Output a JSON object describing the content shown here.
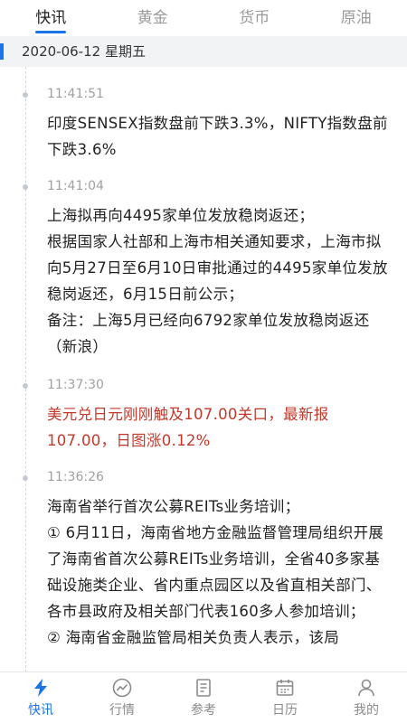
{
  "tabs": [
    {
      "label": "快讯",
      "active": true
    },
    {
      "label": "黄金",
      "active": false
    },
    {
      "label": "货币",
      "active": false
    },
    {
      "label": "原油",
      "active": false
    }
  ],
  "date_header": "2020-06-12 星期五",
  "news": [
    {
      "time": "11:41:51",
      "lines": [
        "印度SENSEX指数盘前下跌3.3%，NIFTY指数盘前下跌3.6%"
      ],
      "highlight": false
    },
    {
      "time": "11:41:04",
      "lines": [
        "上海拟再向4495家单位发放稳岗返还；",
        "根据国家人社部和上海市相关通知要求，上海市拟向5月27日至6月10日审批通过的4495家单位发放稳岗返还，6月15日前公示；",
        "备注：上海5月已经向6792家单位发放稳岗返还　（新浪）"
      ],
      "highlight": false
    },
    {
      "time": "11:37:30",
      "lines": [
        "美元兑日元刚刚触及107.00关口，最新报107.00，日图涨0.12%"
      ],
      "highlight": true,
      "highlight_color": "#c0392b"
    },
    {
      "time": "11:36:26",
      "lines": [
        "海南省举行首次公募REITs业务培训；",
        "① 6月11日，海南省地方金融监督管理局组织开展了海南省首次公募REITs业务培训，全省40多家基础设施类企业、省内重点园区以及省直相关部门、各市县政府及相关部门代表160多人参加培训；",
        "② 海南省金融监管局相关负责人表示，该局"
      ],
      "highlight": false
    }
  ],
  "bottom_nav": [
    {
      "label": "快讯",
      "icon": "lightning-icon",
      "active": true
    },
    {
      "label": "行情",
      "icon": "market-chart-icon",
      "active": false
    },
    {
      "label": "参考",
      "icon": "document-icon",
      "active": false
    },
    {
      "label": "日历",
      "icon": "calendar-icon",
      "active": false
    },
    {
      "label": "我的",
      "icon": "user-icon",
      "active": false
    }
  ],
  "colors": {
    "accent": "#1a73e8",
    "highlight": "#c0392b"
  }
}
